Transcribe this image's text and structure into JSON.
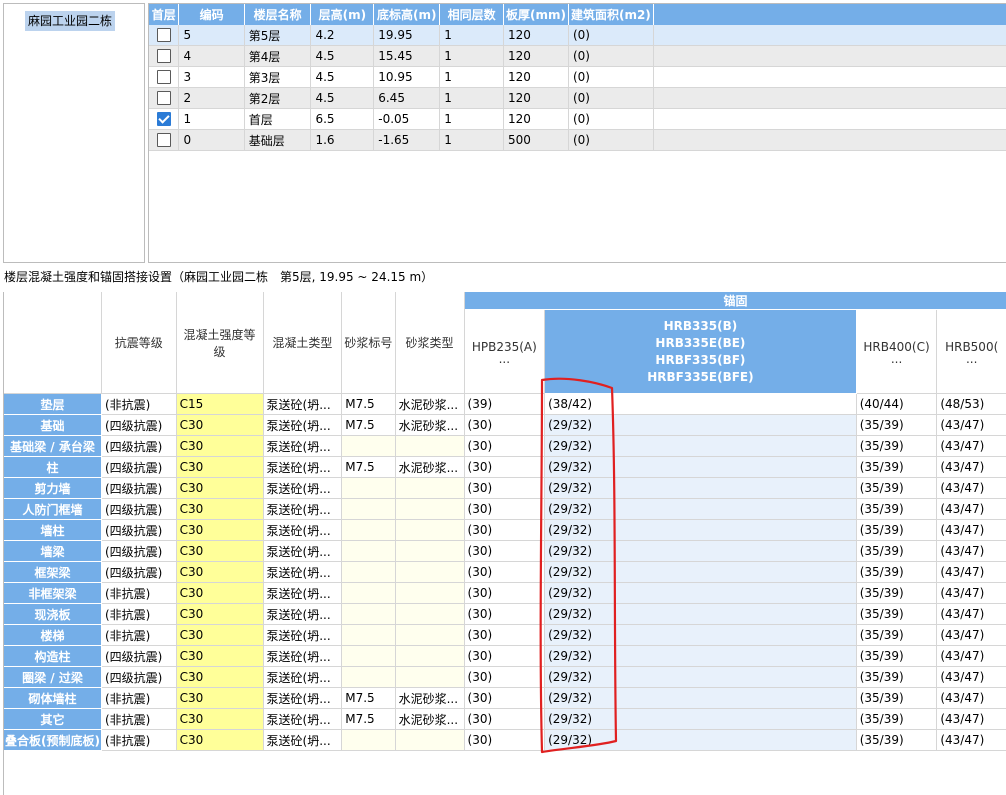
{
  "tree": {
    "project_item": "麻园工业园二栋"
  },
  "floor_table": {
    "headers": [
      "首层",
      "编码",
      "楼层名称",
      "层高(m)",
      "底标高(m)",
      "相同层数",
      "板厚(mm)",
      "建筑面积(m2)"
    ],
    "rows": [
      {
        "checked": false,
        "code": "5",
        "name": "第5层",
        "height": "4.2",
        "bottom": "19.95",
        "same": "1",
        "slab": "120",
        "area": "(0)"
      },
      {
        "checked": false,
        "code": "4",
        "name": "第4层",
        "height": "4.5",
        "bottom": "15.45",
        "same": "1",
        "slab": "120",
        "area": "(0)"
      },
      {
        "checked": false,
        "code": "3",
        "name": "第3层",
        "height": "4.5",
        "bottom": "10.95",
        "same": "1",
        "slab": "120",
        "area": "(0)"
      },
      {
        "checked": false,
        "code": "2",
        "name": "第2层",
        "height": "4.5",
        "bottom": "6.45",
        "same": "1",
        "slab": "120",
        "area": "(0)"
      },
      {
        "checked": true,
        "code": "1",
        "name": "首层",
        "height": "6.5",
        "bottom": "-0.05",
        "same": "1",
        "slab": "120",
        "area": "(0)"
      },
      {
        "checked": false,
        "code": "0",
        "name": "基础层",
        "height": "1.6",
        "bottom": "-1.65",
        "same": "1",
        "slab": "500",
        "area": "(0)"
      }
    ]
  },
  "section_title": "楼层混凝土强度和锚固搭接设置（麻园工业园二栋　第5层, 19.95 ~ 24.15 m）",
  "concrete_table": {
    "headers": {
      "seismic": "抗震等级",
      "strength": "混凝土强度等级",
      "ctype": "混凝土类型",
      "mortar_grade": "砂浆标号",
      "mortar_type": "砂浆类型",
      "anchor_group": "锚固",
      "hpb": "HPB235(A)",
      "hrb335_lines": [
        "HRB335(B)",
        "HRB335E(BE)",
        "HRBF335(BF)",
        "HRBF335E(BFE)"
      ],
      "hrb400": "HRB400(C)",
      "hrb500": "HRB500(",
      "ellipsis": "..."
    },
    "rows": [
      {
        "name": "垫层",
        "seismic": "(非抗震)",
        "strength": "C15",
        "ctype": "泵送砼(坍...",
        "mgrade": "M7.5",
        "mtype": "水泥砂浆...",
        "hpb": "(39)",
        "hrb335": "(38/42)",
        "hrb400": "(40/44)",
        "hrb500": "(48/53)"
      },
      {
        "name": "基础",
        "seismic": "(四级抗震)",
        "strength": "C30",
        "ctype": "泵送砼(坍...",
        "mgrade": "M7.5",
        "mtype": "水泥砂浆...",
        "hpb": "(30)",
        "hrb335": "(29/32)",
        "hrb400": "(35/39)",
        "hrb500": "(43/47)"
      },
      {
        "name": "基础梁 / 承台梁",
        "seismic": "(四级抗震)",
        "strength": "C30",
        "ctype": "泵送砼(坍...",
        "mgrade": "",
        "mtype": "",
        "hpb": "(30)",
        "hrb335": "(29/32)",
        "hrb400": "(35/39)",
        "hrb500": "(43/47)"
      },
      {
        "name": "柱",
        "seismic": "(四级抗震)",
        "strength": "C30",
        "ctype": "泵送砼(坍...",
        "mgrade": "M7.5",
        "mtype": "水泥砂浆...",
        "hpb": "(30)",
        "hrb335": "(29/32)",
        "hrb400": "(35/39)",
        "hrb500": "(43/47)"
      },
      {
        "name": "剪力墙",
        "seismic": "(四级抗震)",
        "strength": "C30",
        "ctype": "泵送砼(坍...",
        "mgrade": "",
        "mtype": "",
        "hpb": "(30)",
        "hrb335": "(29/32)",
        "hrb400": "(35/39)",
        "hrb500": "(43/47)"
      },
      {
        "name": "人防门框墙",
        "seismic": "(四级抗震)",
        "strength": "C30",
        "ctype": "泵送砼(坍...",
        "mgrade": "",
        "mtype": "",
        "hpb": "(30)",
        "hrb335": "(29/32)",
        "hrb400": "(35/39)",
        "hrb500": "(43/47)"
      },
      {
        "name": "墙柱",
        "seismic": "(四级抗震)",
        "strength": "C30",
        "ctype": "泵送砼(坍...",
        "mgrade": "",
        "mtype": "",
        "hpb": "(30)",
        "hrb335": "(29/32)",
        "hrb400": "(35/39)",
        "hrb500": "(43/47)"
      },
      {
        "name": "墙梁",
        "seismic": "(四级抗震)",
        "strength": "C30",
        "ctype": "泵送砼(坍...",
        "mgrade": "",
        "mtype": "",
        "hpb": "(30)",
        "hrb335": "(29/32)",
        "hrb400": "(35/39)",
        "hrb500": "(43/47)"
      },
      {
        "name": "框架梁",
        "seismic": "(四级抗震)",
        "strength": "C30",
        "ctype": "泵送砼(坍...",
        "mgrade": "",
        "mtype": "",
        "hpb": "(30)",
        "hrb335": "(29/32)",
        "hrb400": "(35/39)",
        "hrb500": "(43/47)"
      },
      {
        "name": "非框架梁",
        "seismic": "(非抗震)",
        "strength": "C30",
        "ctype": "泵送砼(坍...",
        "mgrade": "",
        "mtype": "",
        "hpb": "(30)",
        "hrb335": "(29/32)",
        "hrb400": "(35/39)",
        "hrb500": "(43/47)"
      },
      {
        "name": "现浇板",
        "seismic": "(非抗震)",
        "strength": "C30",
        "ctype": "泵送砼(坍...",
        "mgrade": "",
        "mtype": "",
        "hpb": "(30)",
        "hrb335": "(29/32)",
        "hrb400": "(35/39)",
        "hrb500": "(43/47)"
      },
      {
        "name": "楼梯",
        "seismic": "(非抗震)",
        "strength": "C30",
        "ctype": "泵送砼(坍...",
        "mgrade": "",
        "mtype": "",
        "hpb": "(30)",
        "hrb335": "(29/32)",
        "hrb400": "(35/39)",
        "hrb500": "(43/47)"
      },
      {
        "name": "构造柱",
        "seismic": "(四级抗震)",
        "strength": "C30",
        "ctype": "泵送砼(坍...",
        "mgrade": "",
        "mtype": "",
        "hpb": "(30)",
        "hrb335": "(29/32)",
        "hrb400": "(35/39)",
        "hrb500": "(43/47)"
      },
      {
        "name": "圈梁 / 过梁",
        "seismic": "(四级抗震)",
        "strength": "C30",
        "ctype": "泵送砼(坍...",
        "mgrade": "",
        "mtype": "",
        "hpb": "(30)",
        "hrb335": "(29/32)",
        "hrb400": "(35/39)",
        "hrb500": "(43/47)"
      },
      {
        "name": "砌体墙柱",
        "seismic": "(非抗震)",
        "strength": "C30",
        "ctype": "泵送砼(坍...",
        "mgrade": "M7.5",
        "mtype": "水泥砂浆...",
        "hpb": "(30)",
        "hrb335": "(29/32)",
        "hrb400": "(35/39)",
        "hrb500": "(43/47)"
      },
      {
        "name": "其它",
        "seismic": "(非抗震)",
        "strength": "C30",
        "ctype": "泵送砼(坍...",
        "mgrade": "M7.5",
        "mtype": "水泥砂浆...",
        "hpb": "(30)",
        "hrb335": "(29/32)",
        "hrb400": "(35/39)",
        "hrb500": "(43/47)"
      },
      {
        "name": "叠合板(预制底板)",
        "seismic": "(非抗震)",
        "strength": "C30",
        "ctype": "泵送砼(坍...",
        "mgrade": "",
        "mtype": "",
        "hpb": "(30)",
        "hrb335": "(29/32)",
        "hrb400": "(35/39)",
        "hrb500": "(43/47)"
      }
    ]
  },
  "colors": {
    "header_blue": "#74aee8",
    "strength_yellow": "#ffff99",
    "annotation_red": "#e02020",
    "selected_row": "#dbeafa"
  }
}
